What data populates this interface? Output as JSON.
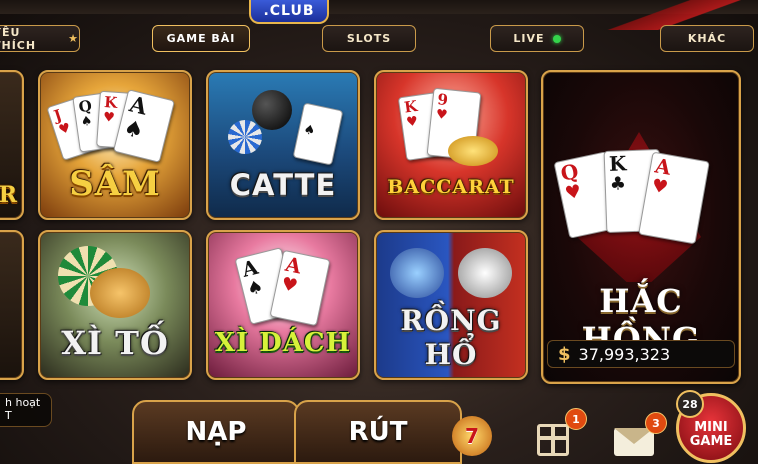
{
  "header": {
    "logo_text": ".CLUB"
  },
  "tabs": [
    {
      "label": "YÊU THÍCH",
      "suffix": "★"
    },
    {
      "label": "GAME BÀI"
    },
    {
      "label": "SLOTS"
    },
    {
      "label": "LIVE"
    },
    {
      "label": "KHÁC"
    }
  ],
  "games": {
    "sam": "SÂM",
    "catte": "CATTE",
    "baccarat": "BACCARAT",
    "xito": "XÌ TỐ",
    "xidach": "XÌ DÁCH",
    "ronghong_line1": "RỒNG",
    "ronghong_line2": "HỔ",
    "hachong": "HẮC HỒNG",
    "left_partial_top": "R"
  },
  "cards": {
    "sam": [
      "J",
      "Q",
      "K",
      "A"
    ],
    "baccarat": [
      "K",
      "9"
    ],
    "xidach": [
      "A",
      "A"
    ],
    "hachong": [
      "Q",
      "K",
      "A"
    ]
  },
  "jackpot": {
    "currency": "$",
    "amount": "37,993,323"
  },
  "left_note": {
    "line1": "h hoạt",
    "line2": "T"
  },
  "bottom": {
    "nap": "NẠP",
    "rut": "RÚT",
    "gift_badge": "1",
    "mail_badge": "3",
    "mini_badge": "28",
    "mini_line1": "MINI",
    "mini_line2": "GAME"
  },
  "colors": {
    "gold_border": "#d9a34a",
    "accent_red": "#c2191a",
    "live_dot": "#34d34b"
  }
}
